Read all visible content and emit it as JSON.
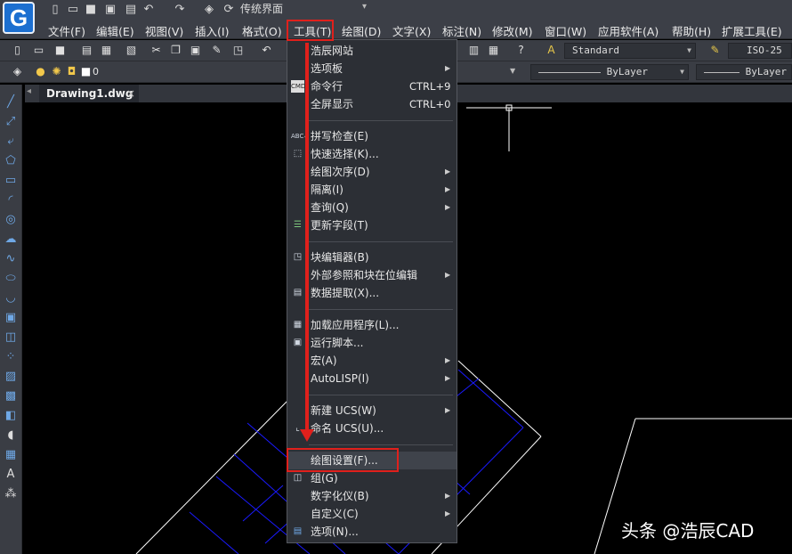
{
  "app": {
    "logo_letter": "G",
    "workspace": "传统界面",
    "workspace_arrow": "▾"
  },
  "menubar": [
    {
      "label": "文件(F)"
    },
    {
      "label": "编辑(E)"
    },
    {
      "label": "视图(V)"
    },
    {
      "label": "插入(I)"
    },
    {
      "label": "格式(O)"
    },
    {
      "label": "工具(T)"
    },
    {
      "label": "绘图(D)"
    },
    {
      "label": "文字(X)"
    },
    {
      "label": "标注(N)"
    },
    {
      "label": "修改(M)"
    },
    {
      "label": "窗口(W)"
    },
    {
      "label": "应用软件(A)"
    },
    {
      "label": "帮助(H)"
    },
    {
      "label": "扩展工具(E)"
    }
  ],
  "toolbar": {
    "text_style": "Standard",
    "dim_style": "ISO-25",
    "layer_name": "0",
    "linetype": "ByLayer",
    "lineweight": "ByLayer"
  },
  "document_tab": {
    "name": "Drawing1.dwg",
    "close": "×"
  },
  "tools_menu": {
    "items": [
      {
        "label": "浩辰网站",
        "shortcut": "",
        "submenu": false,
        "icon": ""
      },
      {
        "label": "选项板",
        "shortcut": "",
        "submenu": true,
        "icon": ""
      },
      {
        "label": "命令行",
        "shortcut": "CTRL+9",
        "submenu": false,
        "icon": "cmd-icon"
      },
      {
        "label": "全屏显示",
        "shortcut": "CTRL+0",
        "submenu": false,
        "icon": ""
      },
      {
        "label": "拼写检查(E)",
        "shortcut": "",
        "submenu": false,
        "icon": "spellcheck-icon"
      },
      {
        "label": "快速选择(K)...",
        "shortcut": "",
        "submenu": false,
        "icon": "quick-select-icon"
      },
      {
        "label": "绘图次序(D)",
        "shortcut": "",
        "submenu": true,
        "icon": ""
      },
      {
        "label": "隔离(I)",
        "shortcut": "",
        "submenu": true,
        "icon": ""
      },
      {
        "label": "查询(Q)",
        "shortcut": "",
        "submenu": true,
        "icon": ""
      },
      {
        "label": "更新字段(T)",
        "shortcut": "",
        "submenu": false,
        "icon": "update-field-icon"
      },
      {
        "label": "块编辑器(B)",
        "shortcut": "",
        "submenu": false,
        "icon": "block-editor-icon"
      },
      {
        "label": "外部参照和块在位编辑",
        "shortcut": "",
        "submenu": true,
        "icon": ""
      },
      {
        "label": "数据提取(X)...",
        "shortcut": "",
        "submenu": false,
        "icon": "data-extract-icon"
      },
      {
        "label": "加载应用程序(L)...",
        "shortcut": "",
        "submenu": false,
        "icon": "load-app-icon"
      },
      {
        "label": "运行脚本...",
        "shortcut": "",
        "submenu": false,
        "icon": "script-icon"
      },
      {
        "label": "宏(A)",
        "shortcut": "",
        "submenu": true,
        "icon": ""
      },
      {
        "label": "AutoLISP(I)",
        "shortcut": "",
        "submenu": true,
        "icon": ""
      },
      {
        "label": "新建 UCS(W)",
        "shortcut": "",
        "submenu": true,
        "icon": ""
      },
      {
        "label": "命名 UCS(U)...",
        "shortcut": "",
        "submenu": false,
        "icon": "named-ucs-icon"
      },
      {
        "label": "绘图设置(F)...",
        "shortcut": "",
        "submenu": false,
        "icon": ""
      },
      {
        "label": "组(G)",
        "shortcut": "",
        "submenu": false,
        "icon": "group-icon"
      },
      {
        "label": "数字化仪(B)",
        "shortcut": "",
        "submenu": true,
        "icon": ""
      },
      {
        "label": "自定义(C)",
        "shortcut": "",
        "submenu": true,
        "icon": ""
      },
      {
        "label": "选项(N)...",
        "shortcut": "",
        "submenu": false,
        "icon": "options-icon"
      }
    ]
  },
  "watermark": "头条 @浩辰CAD",
  "colors": {
    "highlight_red": "#e0201c",
    "menu_bg": "#2c2f35",
    "canvas": "#000000",
    "drawing_blue": "#1a1aff"
  }
}
